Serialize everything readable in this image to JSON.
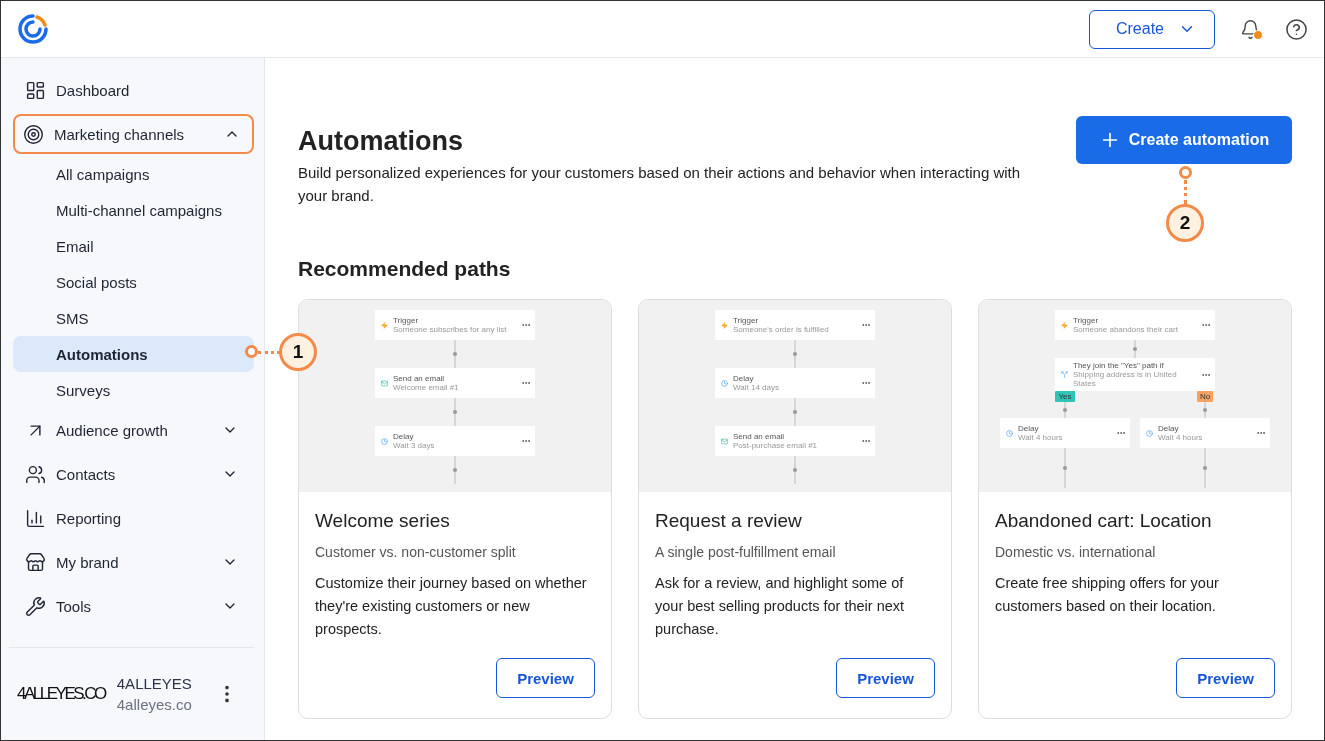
{
  "topbar": {
    "create_button": "Create",
    "notification_dot": true
  },
  "sidebar": {
    "items": [
      {
        "kind": "link",
        "label": "Dashboard",
        "selected": false
      },
      {
        "kind": "group",
        "label": "Marketing channels",
        "expanded": true,
        "highlighted": true,
        "children": [
          {
            "label": "All campaigns",
            "selected": false
          },
          {
            "label": "Multi-channel campaigns",
            "selected": false
          },
          {
            "label": "Email",
            "selected": false
          },
          {
            "label": "Social posts",
            "selected": false
          },
          {
            "label": "SMS",
            "selected": false
          },
          {
            "label": "Automations",
            "selected": true
          },
          {
            "label": "Surveys",
            "selected": false
          }
        ]
      },
      {
        "kind": "group",
        "label": "Audience growth",
        "expanded": false,
        "highlighted": false
      },
      {
        "kind": "group",
        "label": "Contacts",
        "expanded": false,
        "highlighted": false
      },
      {
        "kind": "link",
        "label": "Reporting",
        "selected": false
      },
      {
        "kind": "group",
        "label": "My brand",
        "expanded": false,
        "highlighted": false
      },
      {
        "kind": "group",
        "label": "Tools",
        "expanded": false,
        "highlighted": false
      }
    ],
    "account": {
      "logo": "4ALLEYES.CO",
      "name": "4ALLEYES",
      "domain": "4alleyes.co"
    }
  },
  "page": {
    "title": "Automations",
    "description": "Build personalized experiences for your customers based on their actions and behavior when interacting with your brand.",
    "create_button": "Create automation",
    "section_title": "Recommended paths"
  },
  "cards": [
    {
      "preview": {
        "kind": "linear",
        "nodes": [
          {
            "kind": "trigger",
            "title": "Trigger",
            "subtitle": "Someone subscribes for any list"
          },
          {
            "kind": "email",
            "title": "Send an email",
            "subtitle": "Welcome email #1"
          },
          {
            "kind": "delay",
            "title": "Delay",
            "subtitle": "Wait 3 days"
          }
        ]
      },
      "title": "Welcome series",
      "subtitle": "Customer vs. non-customer split",
      "description": "Customize their journey based on whether they're existing customers or new prospects.",
      "button": "Preview"
    },
    {
      "preview": {
        "kind": "linear",
        "nodes": [
          {
            "kind": "trigger",
            "title": "Trigger",
            "subtitle": "Someone's order is fulfilled"
          },
          {
            "kind": "delay",
            "title": "Delay",
            "subtitle": "Wait 14 days"
          },
          {
            "kind": "email",
            "title": "Send an email",
            "subtitle": "Post-purchase email #1"
          }
        ]
      },
      "title": "Request a review",
      "subtitle": "A single post-fulfillment email",
      "description": "Ask for a review, and highlight some of your best selling products for their next purchase.",
      "button": "Preview"
    },
    {
      "preview": {
        "kind": "split",
        "nodes": [
          {
            "kind": "trigger",
            "title": "Trigger",
            "subtitle": "Someone abandons their cart"
          },
          {
            "kind": "condition",
            "title": "They join the \"Yes\" path if",
            "subtitle": "Shipping address is in United States"
          }
        ],
        "branches": [
          {
            "label": "Yes",
            "color": "#2ec4b6",
            "node": {
              "kind": "delay",
              "title": "Delay",
              "subtitle": "Wait 4 hours"
            }
          },
          {
            "label": "No",
            "color": "#f4a261",
            "node": {
              "kind": "delay",
              "title": "Delay",
              "subtitle": "Wait 4 hours"
            }
          }
        ]
      },
      "title": "Abandoned cart: Location",
      "subtitle": "Domestic vs. international",
      "description": "Create free shipping offers for your customers based on their location.",
      "button": "Preview"
    }
  ],
  "callouts": [
    {
      "label": "1"
    },
    {
      "label": "2"
    }
  ]
}
